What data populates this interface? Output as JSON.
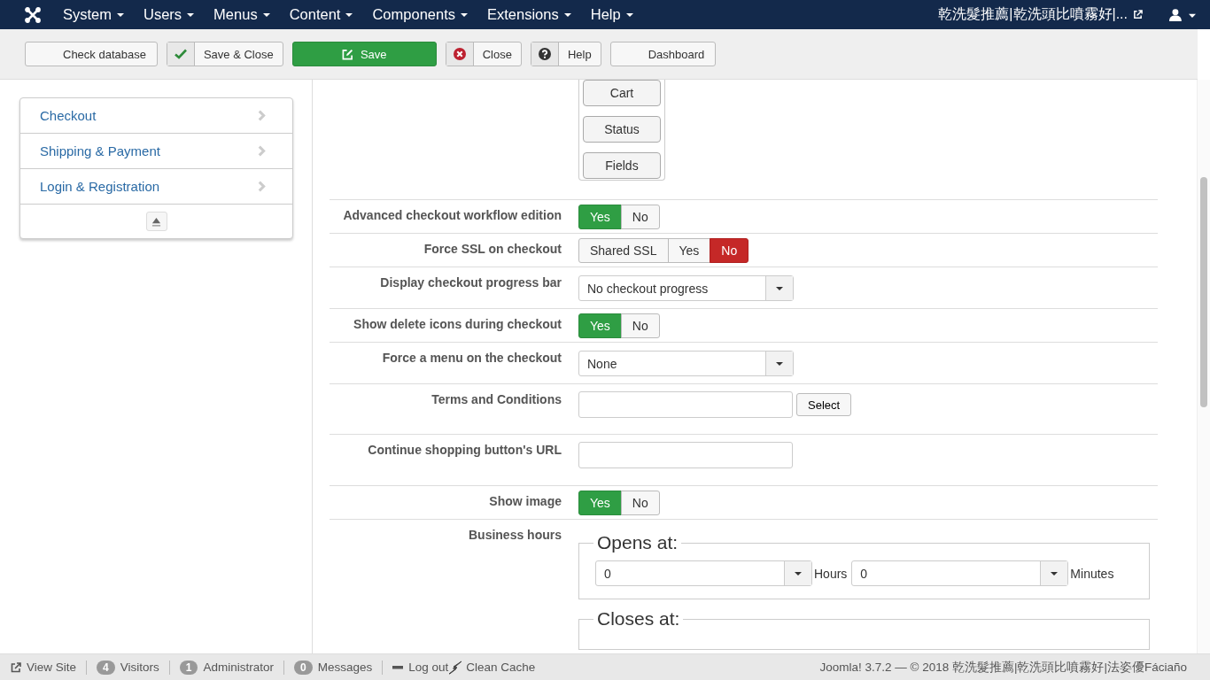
{
  "navbar": {
    "menus": [
      "System",
      "Users",
      "Menus",
      "Content",
      "Components",
      "Extensions",
      "Help"
    ],
    "site_link": "乾洗髮推薦|乾洗頭比噴霧好|..."
  },
  "toolbar": [
    {
      "label": "Check database",
      "kind": "plain"
    },
    {
      "label": "Save & Close",
      "kind": "check"
    },
    {
      "label": "Save",
      "kind": "primary"
    },
    {
      "label": "Close",
      "kind": "cancel"
    },
    {
      "label": "Help",
      "kind": "help"
    },
    {
      "label": "Dashboard",
      "kind": "plain"
    }
  ],
  "sidebar": {
    "items": [
      {
        "label": "Checkout"
      },
      {
        "label": "Shipping & Payment"
      },
      {
        "label": "Login & Registration"
      }
    ]
  },
  "form": {
    "rows": [
      {
        "kind": "buttons",
        "label": "",
        "buttons": [
          "Cart",
          "Status",
          "Fields"
        ]
      },
      {
        "kind": "toggle",
        "label": "Advanced checkout workflow edition",
        "options": [
          {
            "label": "Yes",
            "kind": "yes",
            "selected": true
          },
          {
            "label": "No",
            "selected": false
          }
        ]
      },
      {
        "kind": "toggle",
        "label": "Force SSL on checkout",
        "options": [
          {
            "label": "Shared SSL",
            "selected": false
          },
          {
            "label": "Yes",
            "selected": false
          },
          {
            "label": "No",
            "kind": "no",
            "selected": true
          }
        ]
      },
      {
        "kind": "select",
        "label": "Display checkout progress bar",
        "value": "No checkout progress"
      },
      {
        "kind": "toggle",
        "label": "Show delete icons during checkout",
        "options": [
          {
            "label": "Yes",
            "kind": "yes",
            "selected": true
          },
          {
            "label": "No",
            "selected": false
          }
        ]
      },
      {
        "kind": "select",
        "label": "Force a menu on the checkout",
        "value": "None"
      },
      {
        "kind": "media",
        "label": "Terms and Conditions",
        "button": "Select"
      },
      {
        "kind": "text",
        "label": "Continue shopping button's URL"
      },
      {
        "kind": "toggle",
        "label": "Show image",
        "options": [
          {
            "label": "Yes",
            "kind": "yes",
            "selected": true
          },
          {
            "label": "No",
            "selected": false
          }
        ]
      },
      {
        "kind": "hours",
        "label": "Business hours",
        "groups": [
          {
            "legend": "Opens at:",
            "hours": "0",
            "hours_unit": "Hours",
            "minutes": "0",
            "minutes_unit": "Minutes"
          },
          {
            "legend": "Closes at:"
          }
        ]
      }
    ]
  },
  "status_bar": {
    "view_site": "View Site",
    "badges": [
      {
        "count": "4",
        "label": "Visitors"
      },
      {
        "count": "1",
        "label": "Administrator"
      },
      {
        "count": "0",
        "label": "Messages"
      }
    ],
    "logout": "Log out",
    "clean_cache": "Clean Cache",
    "footer": "Joomla! 3.7.2  —  © 2018 乾洗髮推薦|乾洗頭比噴霧好|法姿優Fáciaño"
  }
}
